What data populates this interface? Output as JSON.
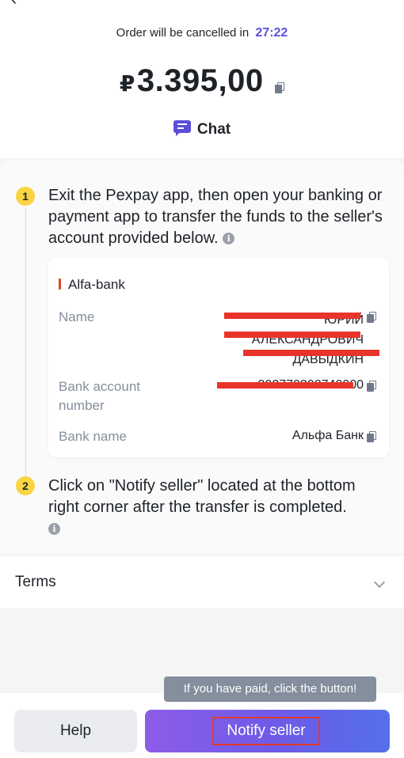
{
  "header": {
    "back_icon": "back-arrow-icon",
    "cancel_prefix": "Order will be cancelled in",
    "timer": "27:22",
    "currency": "₽",
    "amount": "3.395,00",
    "chat_label": "Chat"
  },
  "steps": [
    {
      "number": "1",
      "text": "Exit the Pexpay app, then open your banking or payment app to transfer the funds to the seller's account provided below."
    },
    {
      "number": "2",
      "text": "Click on \"Notify seller\" located at the bottom right corner after the transfer is completed."
    }
  ],
  "bank_card": {
    "bank": "Alfa-bank",
    "name_label": "Name",
    "name_value_lines": [
      "ЮРИЙ",
      "АЛЕКСАНДРОВИЧ",
      "ДАВЫДКИН"
    ],
    "account_label": "Bank account number",
    "account_value": "302770202740000",
    "bankname_label": "Bank name",
    "bankname_value": "Альфа Банк"
  },
  "terms": {
    "label": "Terms"
  },
  "tooltip": "If you have paid, click the button!",
  "buttons": {
    "help": "Help",
    "notify": "Notify seller"
  },
  "colors": {
    "accent": "#5b4fd8",
    "badge": "#fbd442",
    "redaction": "#e8342a",
    "bank_mark": "#e0442b"
  },
  "info_glyph": "i"
}
